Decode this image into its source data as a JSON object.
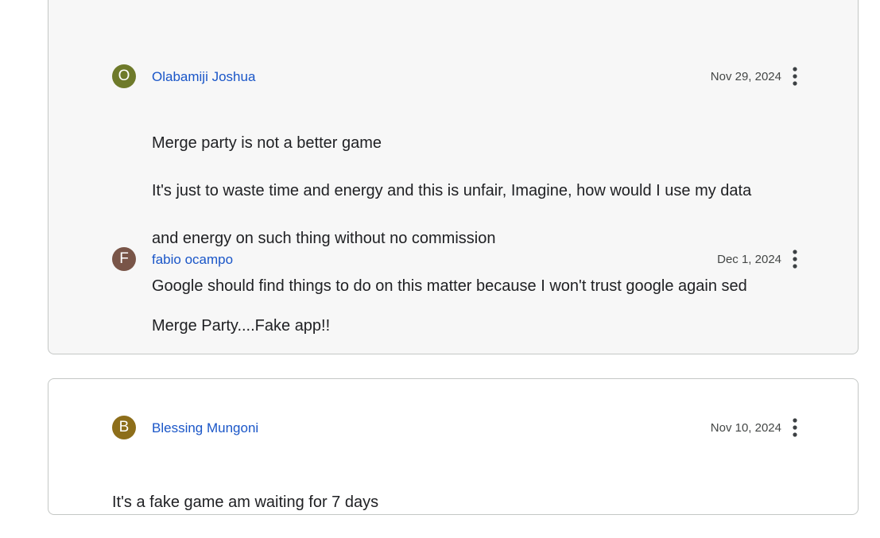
{
  "reviews": [
    {
      "author": "Olabamiji Joshua",
      "initial": "O",
      "avatar_color": "#6e7a2a",
      "date": "Nov 29, 2024",
      "lines": [
        "Merge party is not a better game",
        "It's just to waste time and energy and this is unfair, Imagine, how would I use my data",
        "and energy on such thing without no commission",
        "Google should find things to do on this matter because I won't trust google again sed"
      ]
    },
    {
      "author": "fabio ocampo",
      "initial": "F",
      "avatar_color": "#795548",
      "date": "Dec 1, 2024",
      "lines": [
        "Merge Party....Fake app!!"
      ]
    },
    {
      "author": "Blessing Mungoni",
      "initial": "B",
      "avatar_color": "#8d6e1a",
      "date": "Nov 10, 2024",
      "lines": [
        "It's a fake game am waiting for 7 days"
      ]
    }
  ],
  "icons": {
    "more": "more-vert-icon"
  }
}
